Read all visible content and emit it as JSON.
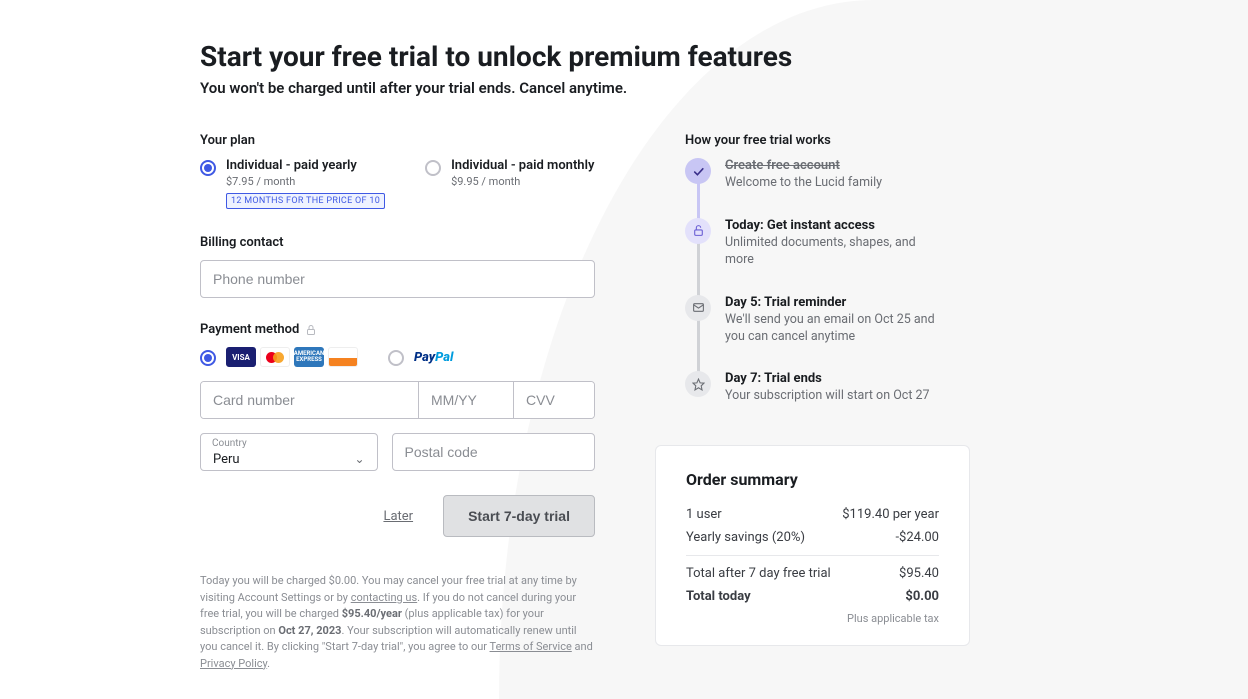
{
  "header": {
    "title": "Start your free trial to unlock premium features",
    "subtitle": "You won't be charged until after your trial ends. Cancel anytime."
  },
  "plan_section": {
    "label": "Your plan",
    "options": [
      {
        "title": "Individual - paid yearly",
        "price": "$7.95 / month",
        "badge": "12 MONTHS FOR THE PRICE OF 10",
        "selected": true
      },
      {
        "title": "Individual - paid monthly",
        "price": "$9.95 / month",
        "selected": false
      }
    ]
  },
  "billing": {
    "label": "Billing contact",
    "phone_placeholder": "Phone number"
  },
  "payment": {
    "label": "Payment method",
    "card_selected": true,
    "paypal_label": "PayPal",
    "card_number_placeholder": "Card number",
    "exp_placeholder": "MM/YY",
    "cvv_placeholder": "CVV",
    "country_label": "Country",
    "country_value": "Peru",
    "postal_placeholder": "Postal code",
    "card_brands": [
      "visa",
      "mastercard",
      "amex",
      "discover"
    ]
  },
  "actions": {
    "later": "Later",
    "submit": "Start 7-day trial"
  },
  "fine_print": {
    "p1a": "Today you will be charged $0.00. You may cancel your free trial at any time by visiting Account Settings or by ",
    "contact": "contacting us",
    "p1b": ". If you do not cancel during your free trial, you will be charged ",
    "rate": "$95.40/year",
    "p1c": " (plus applicable tax) for your subscription on ",
    "date": "Oct 27, 2023",
    "p1d": ". Your subscription will automatically renew until you cancel it. By clicking \"Start 7-day trial\", you agree to our ",
    "tos": "Terms of Service",
    "and": " and ",
    "privacy": "Privacy Policy",
    "end": "."
  },
  "trial_steps": {
    "label": "How your free trial works",
    "steps": [
      {
        "icon": "check",
        "state": "done",
        "title": "Create free account",
        "strike": true,
        "desc": "Welcome to the Lucid family"
      },
      {
        "icon": "lock",
        "state": "active",
        "title": "Today: Get instant access",
        "desc": "Unlimited documents, shapes, and more"
      },
      {
        "icon": "mail",
        "state": "pending",
        "title": "Day 5: Trial reminder",
        "desc": "We'll send you an email on Oct 25 and you can cancel anytime"
      },
      {
        "icon": "star",
        "state": "pending",
        "title": "Day 7: Trial ends",
        "desc": "Your subscription will start on Oct 27"
      }
    ]
  },
  "summary": {
    "title": "Order summary",
    "rows": [
      {
        "label": "1 user",
        "value": "$119.40 per year"
      },
      {
        "label": "Yearly savings (20%)",
        "value": "-$24.00"
      }
    ],
    "total_after_label": "Total after 7 day free trial",
    "total_after_value": "$95.40",
    "total_today_label": "Total today",
    "total_today_value": "$0.00",
    "tax_note": "Plus applicable tax"
  }
}
